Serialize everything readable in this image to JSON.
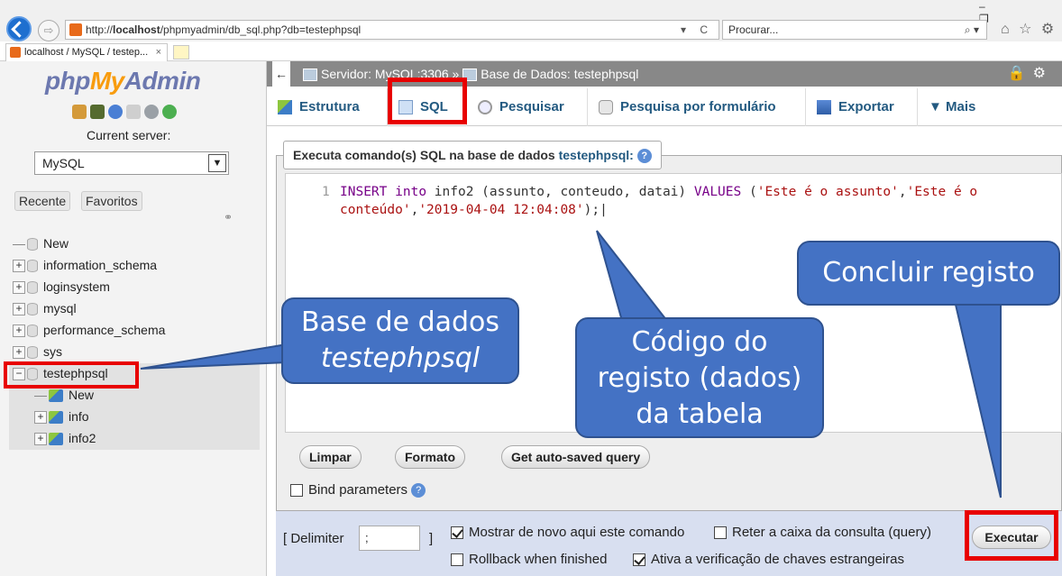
{
  "browser": {
    "url_prefix": "http://",
    "url_host": "localhost",
    "url_path": "/phpmyadmin/db_sql.php?db=testephpsql",
    "url_controls": "▾ C",
    "search_placeholder": "Procurar...",
    "search_controls": "⌕ ▾",
    "right_icons": "⌂ ☆ ⚙",
    "window_controls": "– ❐",
    "tab_title": "localhost / MySQL / testep...",
    "tab_close": "×"
  },
  "nav": {
    "logo_php": "php",
    "logo_my": "My",
    "logo_admin": "Admin",
    "current_server_label": "Current server:",
    "server_value": "MySQL",
    "recent_label": "Recente",
    "favorites_label": "Favoritos",
    "tree": [
      {
        "label": "New"
      },
      {
        "label": "information_schema"
      },
      {
        "label": "loginsystem"
      },
      {
        "label": "mysql"
      },
      {
        "label": "performance_schema"
      },
      {
        "label": "sys"
      },
      {
        "label": "testephpsql"
      },
      {
        "label": "New"
      },
      {
        "label": "info"
      },
      {
        "label": "info2"
      }
    ]
  },
  "breadcrumb": {
    "back": "←",
    "server": "Servidor: MySQL:3306",
    "separator": "»",
    "database": "Base de Dados: testephpsql"
  },
  "tabs": [
    {
      "label": "Estrutura"
    },
    {
      "label": "SQL"
    },
    {
      "label": "Pesquisar"
    },
    {
      "label": "Pesquisa por formulário"
    },
    {
      "label": "Exportar"
    },
    {
      "label": "Mais"
    }
  ],
  "sql": {
    "legend_prefix": "Executa comando(s) SQL na base de dados",
    "legend_db": "testephpsql:",
    "line_number": "1",
    "code_1": "INSERT",
    "code_2": "into",
    "code_3": " info2 (assunto, conteudo, datai) ",
    "code_4": "VALUES",
    "code_5": " (",
    "code_6": "'Este é o assunto'",
    "code_7": ",",
    "code_8": "'Este é o conteúdo'",
    "code_9": ",",
    "code_10": "'2019-04-04 12:04:08'",
    "code_11": ");"
  },
  "buttons": {
    "clear": "Limpar",
    "format": "Formato",
    "autosaved": "Get auto-saved query",
    "execute": "Executar"
  },
  "options": {
    "bind_parameters": "Bind parameters",
    "delimiter_label": "[ Delimiter",
    "delimiter_value": ";",
    "delimiter_close": "]",
    "show_again": "Mostrar de novo aqui este comando",
    "retain_box": "Reter a caixa da consulta (query)",
    "rollback": "Rollback when finished",
    "foreign_keys": "Ativa a verificação de chaves estrangeiras"
  },
  "callouts": {
    "db_line1": "Base de dados",
    "db_line2": "testephpsql",
    "code_line1": "Código do",
    "code_line2": "registo (dados)",
    "code_line3": "da tabela",
    "conclude": "Concluir registo"
  },
  "colors": {
    "callout_fill": "#4472c4",
    "highlight_red": "#e80000",
    "tab_text": "#235a81"
  }
}
